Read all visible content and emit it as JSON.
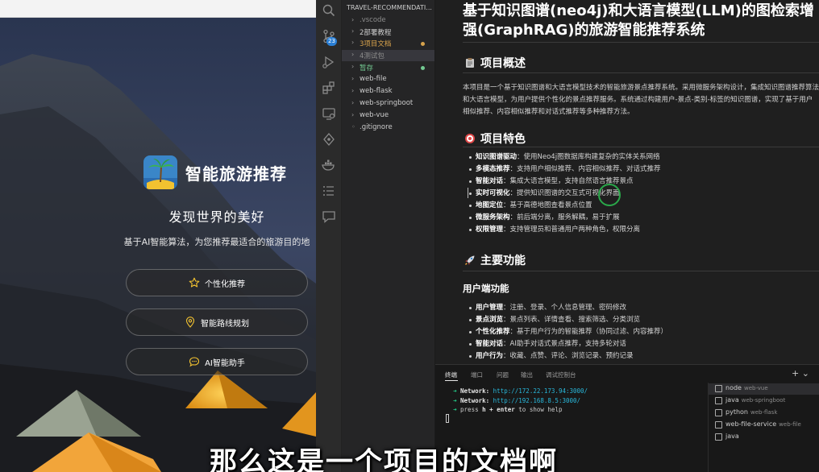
{
  "webapp": {
    "brand_name": "智能旅游推荐",
    "tagline": "发现世界的美好",
    "subtitle": "基于AI智能算法，为您推荐最适合的旅游目的地",
    "buttons": [
      {
        "label": "个性化推荐",
        "icon": "star-icon"
      },
      {
        "label": "智能路线规划",
        "icon": "location-pin-icon"
      },
      {
        "label": "AI智能助手",
        "icon": "chat-bubble-icon"
      }
    ],
    "colors": {
      "accent": "#f2c230"
    }
  },
  "activity_bar": {
    "icons": [
      "search-icon",
      "source-control-icon",
      "run-debug-icon",
      "extensions-icon",
      "remote-explorer-icon",
      "git-history-icon",
      "docker-icon",
      "list-icon",
      "chat-icon"
    ],
    "scm_badge": "23"
  },
  "explorer": {
    "title": "TRAVEL-RECOMMENDATI...",
    "items": [
      {
        "chevron": "›",
        "label": ".vscode",
        "color": "gray"
      },
      {
        "chevron": "›",
        "label": "2部署教程",
        "color": "default"
      },
      {
        "chevron": "›",
        "label": "3项目文档",
        "color": "orange",
        "dot": "#d7a24c"
      },
      {
        "chevron": "›",
        "label": "4测试包",
        "color": "gray"
      },
      {
        "chevron": "›",
        "label": "暂存",
        "color": "green",
        "dot": "#73c991"
      },
      {
        "chevron": "›",
        "label": "web-file",
        "color": "default"
      },
      {
        "chevron": "›",
        "label": "web-flask",
        "color": "default"
      },
      {
        "chevron": "›",
        "label": "web-springboot",
        "color": "default"
      },
      {
        "chevron": "›",
        "label": "web-vue",
        "color": "default"
      },
      {
        "chevron": "◦",
        "label": ".gitignore",
        "color": "default"
      }
    ]
  },
  "preview": {
    "title": "基于知识图谱(neo4j)和大语言模型(LLM)的图检索增强(GraphRAG)的旅游智能推荐系统",
    "overview_heading": "项目概述",
    "overview_text": "本项目是一个基于知识图谱和大语言模型技术的智能旅游景点推荐系统。采用微服务架构设计，集成知识图谱推荐算法和大语言模型，为用户提供个性化的景点推荐服务。系统通过构建用户-景点-类别-标签的知识图谱，实现了基于用户相似推荐、内容相似推荐和对话式推荐等多种推荐方法。",
    "features_heading": "项目特色",
    "features": [
      {
        "term": "知识图谱驱动",
        "desc": "：使用Neo4j图数据库构建复杂的实体关系网络"
      },
      {
        "term": "多模态推荐",
        "desc": "：支持用户相似推荐、内容相似推荐、对话式推荐"
      },
      {
        "term": "智能对话",
        "desc": "：集成大语言模型，支持自然语言推荐景点"
      },
      {
        "term": "实时可视化",
        "desc": "：提供知识图谱的交互式可视化界面"
      },
      {
        "term": "地图定位",
        "desc": "：基于高德地图查看景点位置"
      },
      {
        "term": "微服务架构",
        "desc": "：前后端分离，服务解耦，易于扩展"
      },
      {
        "term": "权限管理",
        "desc": "：支持管理员和普通用户两种角色，权限分离"
      }
    ],
    "functions_heading": "主要功能",
    "user_functions_heading": "用户端功能",
    "user_functions": [
      {
        "term": "用户管理",
        "desc": "：注册、登录、个人信息管理、密码修改"
      },
      {
        "term": "景点浏览",
        "desc": "：景点列表、详情查看、搜索筛选、分类浏览"
      },
      {
        "term": "个性化推荐",
        "desc": "：基于用户行为的智能推荐（协同过滤、内容推荐）"
      },
      {
        "term": "智能对话",
        "desc": "：AI助手对话式景点推荐，支持多轮对话"
      },
      {
        "term": "用户行为",
        "desc": "：收藏、点赞、评论、浏览记录、预约记录"
      }
    ]
  },
  "panel": {
    "tabs": [
      "终端",
      "端口",
      "问题",
      "输出",
      "调试控制台"
    ],
    "actions": "+ ⌄",
    "terminal_lines": [
      {
        "arrow": "➜",
        "label": "Network:",
        "url": "http://172.22.173.94:3000/"
      },
      {
        "arrow": "➜",
        "label": "Network:",
        "url": "http://192.168.8.5:3000/"
      },
      {
        "arrow": "➜",
        "text_before": "press ",
        "key": "h + enter",
        "text_after": " to show help"
      }
    ],
    "terminals": [
      {
        "name": "node",
        "sub": "web-vue"
      },
      {
        "name": "java",
        "sub": "web-springboot"
      },
      {
        "name": "python",
        "sub": "web-flask"
      },
      {
        "name": "web-file-service",
        "sub": "web-file"
      },
      {
        "name": "java",
        "sub": ""
      }
    ]
  },
  "caption": "那么这是一个项目的文档啊"
}
